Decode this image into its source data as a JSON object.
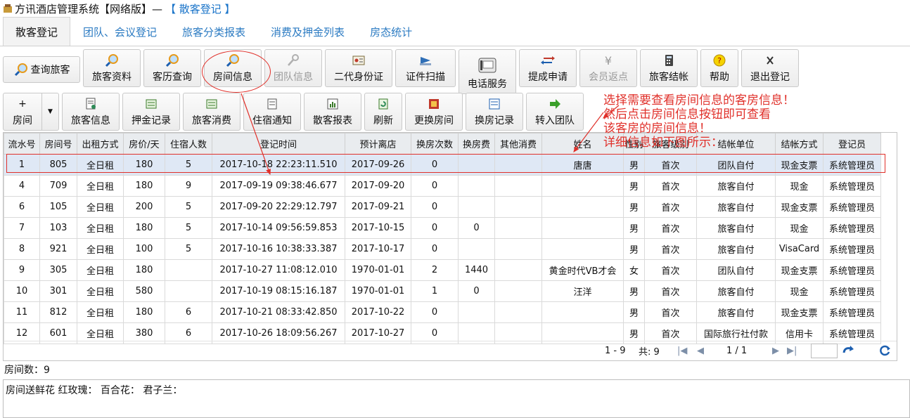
{
  "window": {
    "title": "方讯酒店管理系统【网络版】—",
    "subtitle": "【 散客登记 】"
  },
  "tabs": [
    "散客登记",
    "团队、会议登记",
    "旅客分类报表",
    "消费及押金列表",
    "房态统计"
  ],
  "toolbar1": {
    "query_guest": "查询旅客",
    "guest_info": "旅客资料",
    "history": "客历查询",
    "room_info": "房间信息",
    "team_info": "团队信息",
    "id_card": "二代身份证",
    "doc_scan": "证件扫描",
    "phone": "电话服务",
    "commission": "提成申请",
    "member_rebate": "会员返点",
    "checkout": "旅客结帐",
    "help": "帮助",
    "exit": "退出登记"
  },
  "toolbar2": {
    "room": "房间",
    "guest_info": "旅客信息",
    "deposit": "押金记录",
    "consume": "旅客消费",
    "notice": "住宿通知",
    "report": "散客报表",
    "refresh": "刷新",
    "change_room": "更换房间",
    "change_log": "换房记录",
    "to_team": "转入团队"
  },
  "table": {
    "headers": [
      "流水号",
      "房间号",
      "出租方式",
      "房价/天",
      "住宿人数",
      "登记时间",
      "预计离店",
      "换房次数",
      "换房费",
      "其他消费",
      "姓名",
      "性别",
      "旅客级别",
      "结帐单位",
      "结帐方式",
      "登记员"
    ],
    "rows": [
      [
        "1",
        "805",
        "全日租",
        "180",
        "5",
        "2017-10-18 22:23:11.510",
        "2017-09-26",
        "0",
        "",
        "",
        "唐唐",
        "男",
        "首次",
        "团队自付",
        "现金支票",
        "系统管理员"
      ],
      [
        "4",
        "709",
        "全日租",
        "180",
        "9",
        "2017-09-19 09:38:46.677",
        "2017-09-20",
        "0",
        "",
        "",
        "",
        "男",
        "首次",
        "旅客自付",
        "现金",
        "系统管理员"
      ],
      [
        "6",
        "105",
        "全日租",
        "200",
        "5",
        "2017-09-20 22:29:12.797",
        "2017-09-21",
        "0",
        "",
        "",
        "",
        "男",
        "首次",
        "旅客自付",
        "现金支票",
        "系统管理员"
      ],
      [
        "7",
        "103",
        "全日租",
        "180",
        "5",
        "2017-10-14 09:56:59.853",
        "2017-10-15",
        "0",
        "0",
        "",
        "",
        "男",
        "首次",
        "旅客自付",
        "现金",
        "系统管理员"
      ],
      [
        "8",
        "921",
        "全日租",
        "100",
        "5",
        "2017-10-16 10:38:33.387",
        "2017-10-17",
        "0",
        "",
        "",
        "",
        "男",
        "首次",
        "旅客自付",
        "VisaCard",
        "系统管理员"
      ],
      [
        "9",
        "305",
        "全日租",
        "180",
        "",
        "2017-10-27 11:08:12.010",
        "1970-01-01",
        "2",
        "1440",
        "",
        "黄金时代VB才会",
        "女",
        "首次",
        "团队自付",
        "现金支票",
        "系统管理员"
      ],
      [
        "10",
        "301",
        "全日租",
        "580",
        "",
        "2017-10-19 08:15:16.187",
        "1970-01-01",
        "1",
        "0",
        "",
        "汪洋",
        "男",
        "首次",
        "旅客自付",
        "现金",
        "系统管理员"
      ],
      [
        "11",
        "812",
        "全日租",
        "180",
        "6",
        "2017-10-21 08:33:42.850",
        "2017-10-22",
        "0",
        "",
        "",
        "",
        "男",
        "首次",
        "旅客自付",
        "现金支票",
        "系统管理员"
      ],
      [
        "12",
        "601",
        "全日租",
        "380",
        "6",
        "2017-10-26 18:09:56.267",
        "2017-10-27",
        "0",
        "",
        "",
        "",
        "男",
        "首次",
        "国际旅行社付款",
        "信用卡",
        "系统管理员"
      ]
    ]
  },
  "pager": {
    "range": "1 - 9",
    "total": "共: 9",
    "pages": "1 / 1"
  },
  "room_count": "房间数：9",
  "note": "房间送鲜花 红玫瑰： 百合花： 君子兰：",
  "annotation": {
    "line1": "选择需要查看房间信息的客房信息！",
    "line2": "然后点击房间信息按钮即可查看",
    "line3": "该客房的房间信息！",
    "line4": "详细信息如下图所示："
  },
  "colors": {
    "annotation": "#e0302a",
    "link": "#2a7ac2",
    "selected_row": "#dfe8f5"
  },
  "icons": [
    "magnifier-icon",
    "key-icon",
    "id-card-icon",
    "scan-icon",
    "phone-icon",
    "commission-icon",
    "yen-icon",
    "calculator-icon",
    "help-icon",
    "exit-icon",
    "plus-icon",
    "refresh-icon"
  ]
}
